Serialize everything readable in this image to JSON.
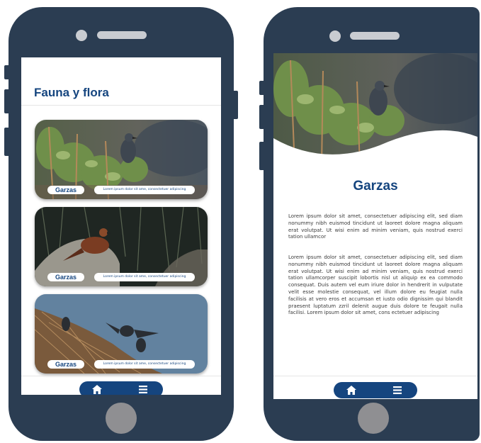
{
  "colors": {
    "phone_body": "#2b3d52",
    "accent": "#15457f",
    "screen": "#ffffff",
    "home_button": "#8f8f92"
  },
  "list_screen": {
    "title": "Fauna y flora",
    "cards": [
      {
        "label": "Garzas",
        "description": "Lorem ipsum dolor sit ame, consectetuer adipiscing"
      },
      {
        "label": "Garzas",
        "description": "Lorem ipsum dolor sit ame, consectetuer adipiscing"
      },
      {
        "label": "Garzas",
        "description": "Lorem ipsum dolor sit ame, consectetuer adipiscing"
      }
    ],
    "nav": {
      "home_icon": "home-icon",
      "menu_icon": "menu-icon"
    }
  },
  "detail_screen": {
    "title": "Garzas",
    "paragraph_1": "Lorem ipsum dolor sit amet, consectetuer adipiscing elit, sed diam nonummy nibh euismod tincidunt ut laoreet dolore magna aliquam erat volutpat. Ut wisi enim ad minim veniam, quis nostrud exerci tation ullamcor",
    "paragraph_2": "Lorem ipsum dolor sit amet, consectetuer adipiscing elit, sed diam nonummy nibh euismod tincidunt ut laoreet dolore magna aliquam erat volutpat. Ut wisi enim ad minim veniam, quis nostrud exerci tation ullamcorper suscipit lobortis nisl ut aliquip ex ea commodo consequat. Duis autem vel eum iriure dolor in hendrerit in vulputate velit esse molestie consequat, vel illum dolore eu feugiat nulla facilisis at vero eros et accumsan et iusto odio dignissim qui blandit praesent luptatum zzril delenit augue duis dolore te feugait nulla facilisi. Lorem ipsum dolor sit amet, cons ectetuer adipiscing",
    "nav": {
      "home_icon": "home-icon",
      "menu_icon": "menu-icon"
    }
  }
}
